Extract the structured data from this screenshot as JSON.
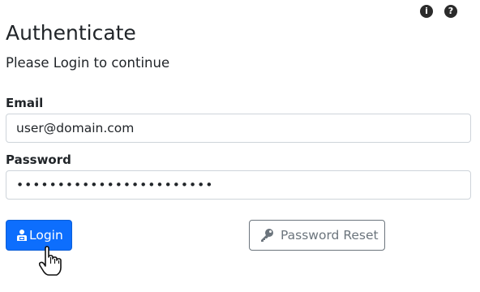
{
  "header": {
    "title": "Authenticate",
    "subtitle": "Please Login to continue",
    "info_icon_glyph": "i",
    "help_icon_glyph": "?"
  },
  "form": {
    "email_label": "Email",
    "email_value": "user@domain.com",
    "password_label": "Password",
    "password_value": "••••••••••••••••••••••••"
  },
  "actions": {
    "login_label": "Login",
    "reset_label": "Password Reset"
  },
  "icons": {
    "info": "info-circle-icon",
    "help": "question-circle-icon",
    "login": "user-lock-icon",
    "reset": "key-icon",
    "cursor": "hand-pointer-icon"
  },
  "colors": {
    "primary": "#0d6efd",
    "secondary": "#6c757d",
    "text": "#212529",
    "border": "#ced4da"
  }
}
